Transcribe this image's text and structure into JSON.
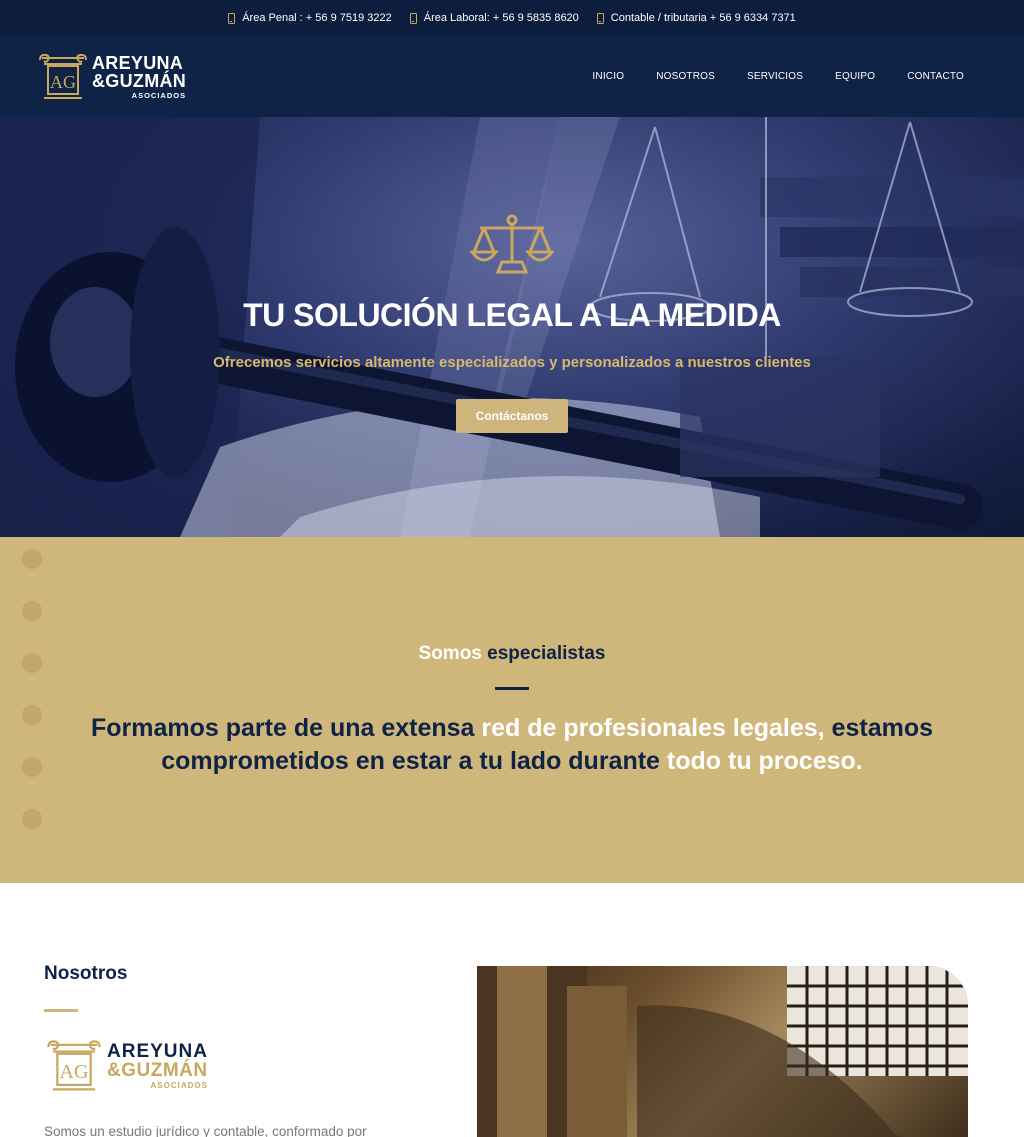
{
  "topbar": {
    "items": [
      {
        "icon": "phone-icon",
        "text": "Área Penal : + 56 9 7519 3222"
      },
      {
        "icon": "phone-icon",
        "text": "Área Laboral: + 56 9 5835 8620"
      },
      {
        "icon": "phone-icon",
        "text": "Contable / tributaria + 56 9 6334 7371"
      }
    ]
  },
  "brand": {
    "line1": "AREYUNA",
    "line2": "&GUZMÁN",
    "line3": "ASOCIADOS",
    "monogram": "AG"
  },
  "nav": {
    "items": [
      "INICIO",
      "NOSOTROS",
      "SERVICIOS",
      "EQUIPO",
      "CONTACTO"
    ]
  },
  "hero": {
    "icon": "scales-of-justice-icon",
    "title": "TU SOLUCIÓN LEGAL A LA MEDIDA",
    "subtitle": "Ofrecemos servicios altamente especializados y personalizados a nuestros clientes",
    "cta": "Contáctanos"
  },
  "specialists": {
    "kicker_a": "Somos",
    "kicker_b": "especialistas",
    "text_1": "Formamos parte de una extensa ",
    "text_2": "red de profesionales legales,",
    "text_3": " estamos comprometidos en estar a tu lado durante ",
    "text_4": "todo tu proceso."
  },
  "about": {
    "title": "Nosotros",
    "text": "Somos un estudio jurídico y contable, conformado por"
  },
  "colors": {
    "navy": "#0f2347",
    "gold": "#cfb77b",
    "gold_text": "#d8b86f"
  }
}
